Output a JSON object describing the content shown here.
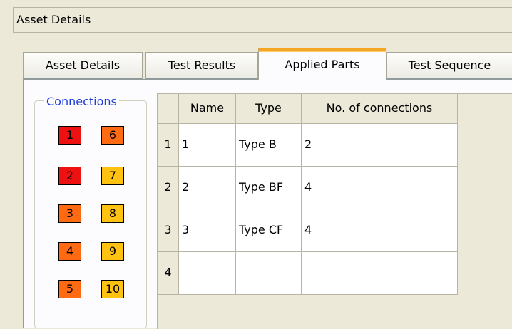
{
  "window": {
    "title": "Asset Details"
  },
  "tabs": [
    {
      "label": "Asset Details",
      "active": false
    },
    {
      "label": "Test Results",
      "active": false
    },
    {
      "label": "Applied Parts",
      "active": true
    },
    {
      "label": "Test Sequence",
      "active": false
    }
  ],
  "connections": {
    "label": "Connections",
    "items": [
      {
        "label": "1",
        "color": "#ee1111"
      },
      {
        "label": "6",
        "color": "#ff6a12"
      },
      {
        "label": "2",
        "color": "#ee1111"
      },
      {
        "label": "7",
        "color": "#ffc211"
      },
      {
        "label": "3",
        "color": "#ff6a12"
      },
      {
        "label": "8",
        "color": "#ffc211"
      },
      {
        "label": "4",
        "color": "#ff6a12"
      },
      {
        "label": "9",
        "color": "#ffc211"
      },
      {
        "label": "5",
        "color": "#ff6a12"
      },
      {
        "label": "10",
        "color": "#ffc211"
      }
    ]
  },
  "grid": {
    "columns": [
      "Name",
      "Type",
      "No. of connections"
    ],
    "rows": [
      {
        "num": "1",
        "name": "1",
        "type": "Type B",
        "connections": "2"
      },
      {
        "num": "2",
        "name": "2",
        "type": "Type BF",
        "connections": "4"
      },
      {
        "num": "3",
        "name": "3",
        "type": "Type CF",
        "connections": "4"
      },
      {
        "num": "4",
        "name": "",
        "type": "",
        "connections": ""
      }
    ]
  }
}
